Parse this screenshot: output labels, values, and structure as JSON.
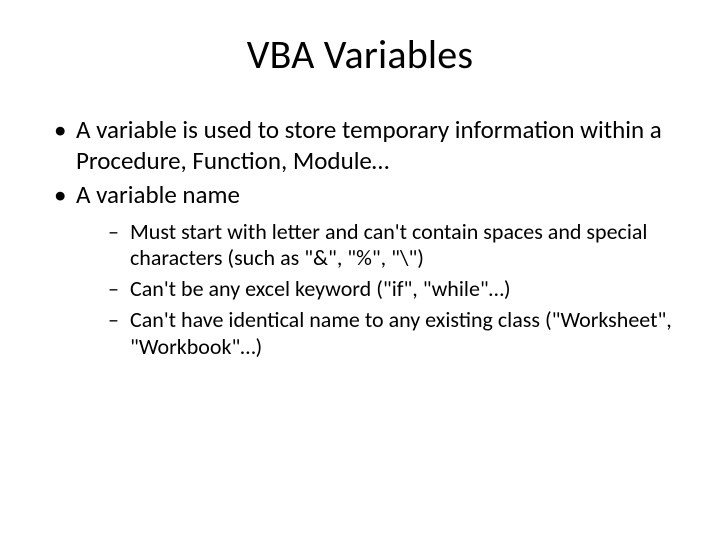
{
  "title": "VBA Variables",
  "bullets": [
    {
      "text": "A variable is used to store temporary information within a Procedure, Function, Module…"
    },
    {
      "text": "A variable name",
      "children": [
        "Must start with letter and can't contain spaces and special characters (such as \"&\", \"%\", \"\\\")",
        "Can't be any excel keyword (\"if\", \"while\"…)",
        "Can't have identical name to any existing class (\"Worksheet\", \"Workbook\"…)"
      ]
    }
  ]
}
